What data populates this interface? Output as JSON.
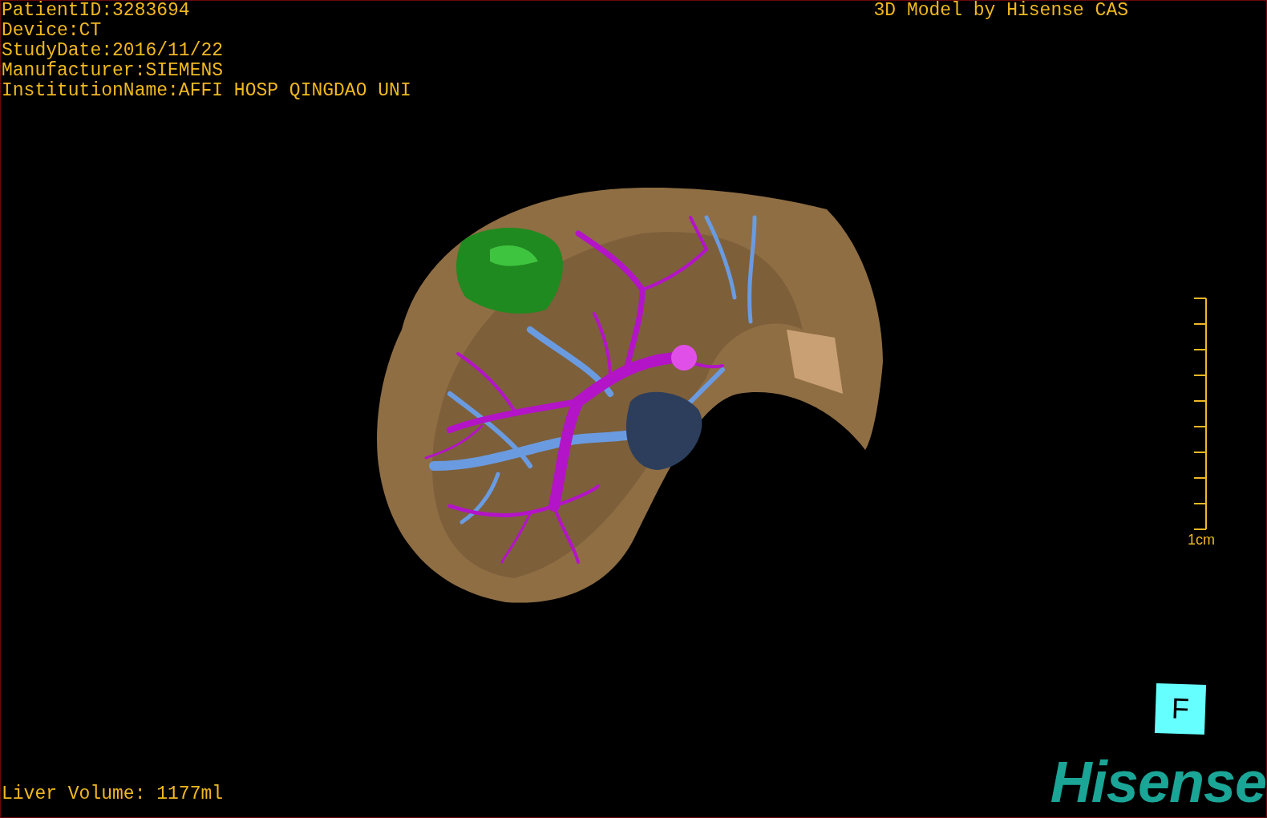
{
  "patient_info": [
    "PatientID:3283694",
    "Device:CT",
    "StudyDate:2016/11/22",
    "Manufacturer:SIEMENS",
    "InstitutionName:AFFI HOSP QINGDAO UNI"
  ],
  "title": "3D Model by Hisense CAS",
  "scale_bar": {
    "label": "1cm"
  },
  "liver_volume": "Liver Volume: 1177ml",
  "orientation_marker": "F",
  "logo": "Hisense"
}
